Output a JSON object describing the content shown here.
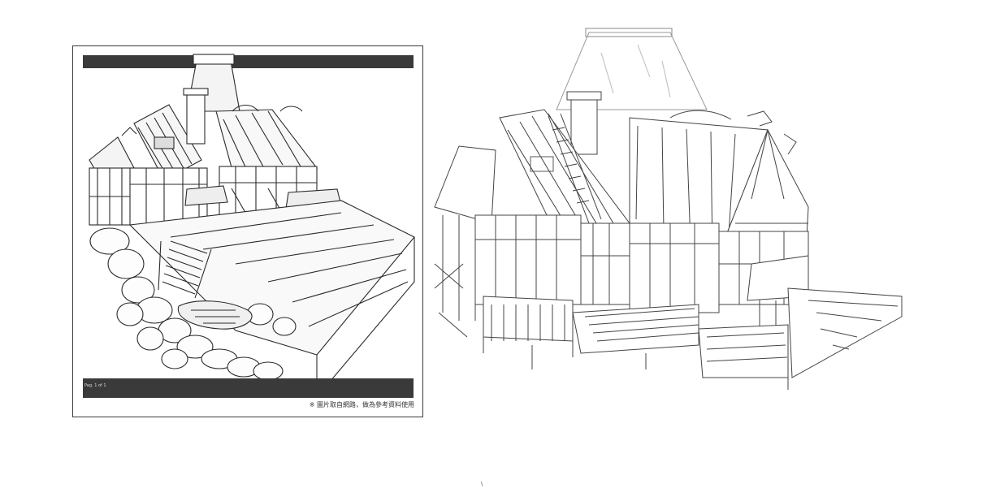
{
  "reference_panel": {
    "caption": "※ 圖片取自網路，做為參考資料使用",
    "page_tag": "Pag. 1 of 1"
  },
  "bottom_mark": "\\",
  "subjects": {
    "left": "house-illustration-icon",
    "right": "house-sketch-icon"
  }
}
